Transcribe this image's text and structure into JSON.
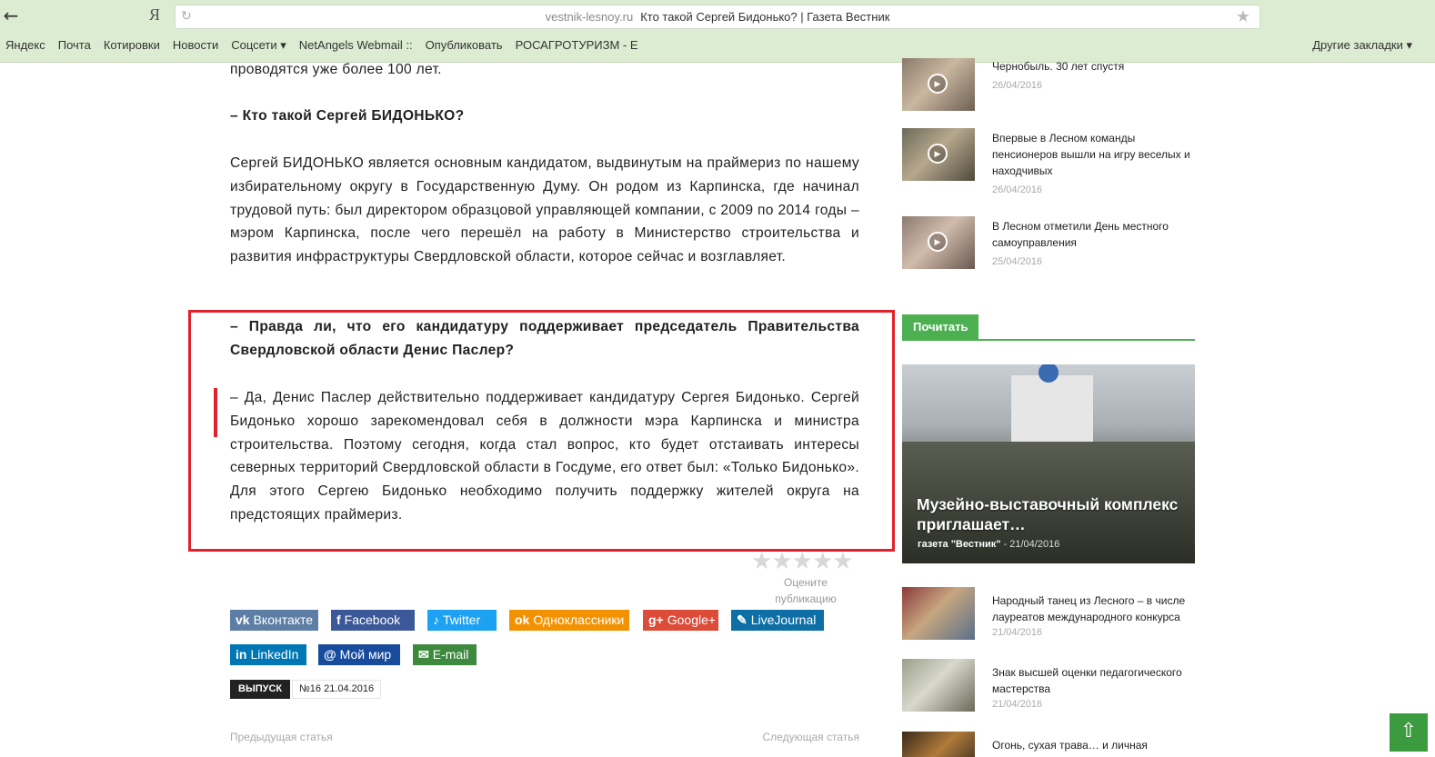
{
  "browser": {
    "ya": "Я",
    "domain": "vestnik-lesnoy.ru",
    "page_title": "Кто такой Сергей Бидонько? | Газета Вестник",
    "bookmarks": [
      "Яндекс",
      "Почта",
      "Котировки",
      "Новости",
      "Соцсети ▾",
      "NetAngels Webmail ::",
      "Опубликовать",
      "РОСАГРОТУРИЗМ - Е"
    ],
    "other_bookmarks": "Другие закладки ▾"
  },
  "article": {
    "intro": "проводятся уже более 100 лет.",
    "q1": "– Кто такой Сергей БИДОНЬКО?",
    "a1": "Сергей БИДОНЬКО является основным кандидатом, выдвинутым на праймериз по нашему избирательному округу в Государственную Думу. Он родом из Карпинска, где начинал трудовой путь: был директором образцовой управляющей компании, с 2009 по 2014 годы – мэром Карпинска, после чего перешёл на работу в Министерство строительства и развития инфраструктуры Свердловской области, которое сейчас и возглавляет.",
    "q2": "– Правда ли, что его кандидатуру поддерживает председатель Правительства Свердловской области Денис Паслер?",
    "a2": "– Да, Денис Паслер действительно поддерживает кандидатуру Сергея Бидонько. Сергей Бидонько хорошо зарекомендовал себя в должности мэра Карпинска и министра строительства. Поэтому сегодня, когда стал вопрос, кто будет отстаивать интересы северных территорий Свердловской области в Госдуме, его ответ был: «Только Бидонько». Для этого Сергею Бидонько необходимо получить поддержку жителей округа на предстоящих праймериз."
  },
  "rating": {
    "label": "Оцените публикацию",
    "stars": 0,
    "max_stars": 5
  },
  "share": {
    "vk": "Вконтакте",
    "facebook": "Facebook",
    "twitter": "Twitter",
    "ok": "Одноклассники",
    "gplus": "Google+",
    "livejournal": "LiveJournal",
    "linkedin": "LinkedIn",
    "moimir": "Мой мир",
    "email": "E-mail"
  },
  "issue": {
    "label": "ВЫПУСК",
    "value": "№16 21.04.2016"
  },
  "nav": {
    "prev": "Предыдущая статья",
    "next": "Следующая статья"
  },
  "sidebar": {
    "videos": [
      {
        "title": "Чернобыль. 30 лет спустя",
        "date": "26/04/2016"
      },
      {
        "title": "Впервые в Лесном команды пенсионеров вышли на игру веселых и находчивых",
        "date": "26/04/2016"
      },
      {
        "title": "В Лесном отметили День местного самоуправления",
        "date": "25/04/2016"
      }
    ],
    "section_title": "Почитать",
    "feature": {
      "title": "Музейно-выставочный комплекс приглашает…",
      "author": "газета \"Вестник\"",
      "date": "21/04/2016"
    },
    "articles": [
      {
        "title": "Народный танец из Лесного – в числе лауреатов международного конкурса",
        "date": "21/04/2016"
      },
      {
        "title": "Знак высшей оценки педагогического мастерства",
        "date": "21/04/2016"
      },
      {
        "title": "Огонь, сухая трава… и личная",
        "date": ""
      }
    ]
  },
  "icons": {
    "back": "back-arrow-icon",
    "reload": "reload-icon",
    "star": "bookmark-star-icon",
    "play": "play-icon",
    "scroll_top": "arrow-up-icon"
  },
  "colors": {
    "chrome": "#dcecd2",
    "highlight": "#e0222a",
    "accent": "#4caf50"
  }
}
